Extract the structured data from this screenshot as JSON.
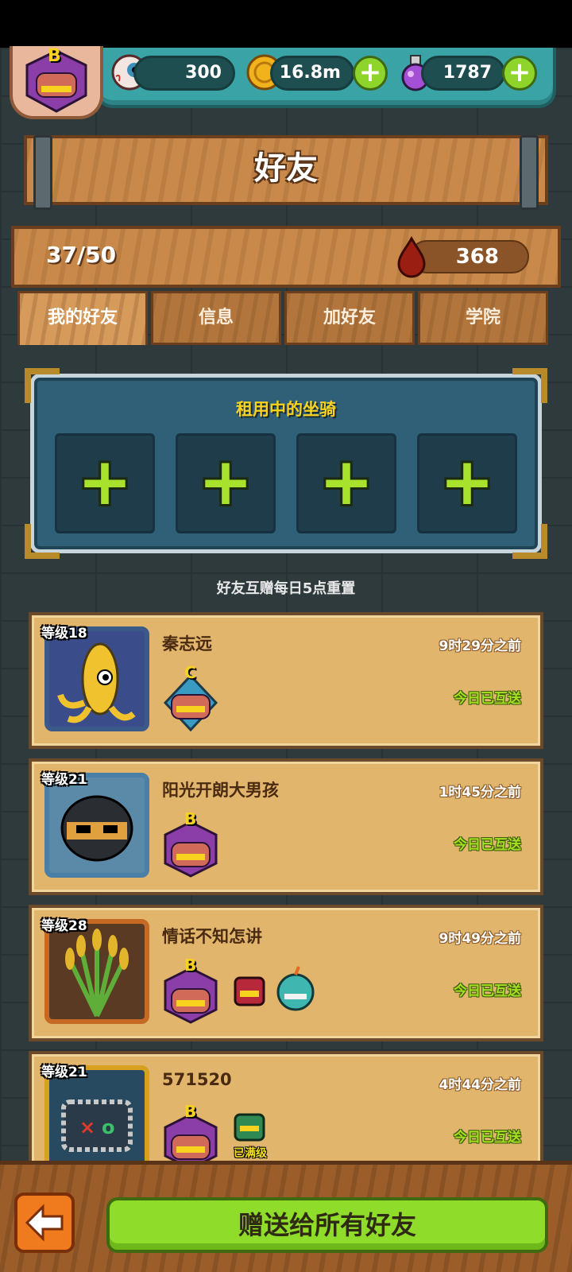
{
  "resources": {
    "eyeballs": "300",
    "coins": "16.8m",
    "potions": "1787",
    "plus_glyph": "+",
    "player_badge": "B"
  },
  "header": {
    "title": "好友"
  },
  "friend_stats": {
    "count": "37/50",
    "blood": "368"
  },
  "tabs": [
    {
      "label": "我的好友",
      "active": true
    },
    {
      "label": "信息",
      "active": false
    },
    {
      "label": "加好友",
      "active": false
    },
    {
      "label": "学院",
      "active": false
    }
  ],
  "mounts": {
    "title": "租用中的坐骑",
    "slot_glyph": "+"
  },
  "reset_note": "好友互赠每日5点重置",
  "friends": [
    {
      "level": "等级18",
      "name": "秦志远",
      "time": "9时29分之前",
      "status": "今日已互送",
      "badge": "C"
    },
    {
      "level": "等级21",
      "name": "阳光开朗大男孩",
      "time": "1时45分之前",
      "status": "今日已互送",
      "badge": "B"
    },
    {
      "level": "等级28",
      "name": "情话不知怎讲",
      "time": "9时49分之前",
      "status": "今日已互送",
      "badge": "B"
    },
    {
      "level": "等级21",
      "name": "571520",
      "time": "4时44分之前",
      "status": "今日已互送",
      "badge": "B",
      "maxed_label": "已满级"
    }
  ],
  "footer": {
    "gift_all": "赠送给所有好友"
  },
  "colors": {
    "accent_green": "#8fdc2a",
    "gold_text": "#f7d21f",
    "wood": "#c9894a"
  }
}
